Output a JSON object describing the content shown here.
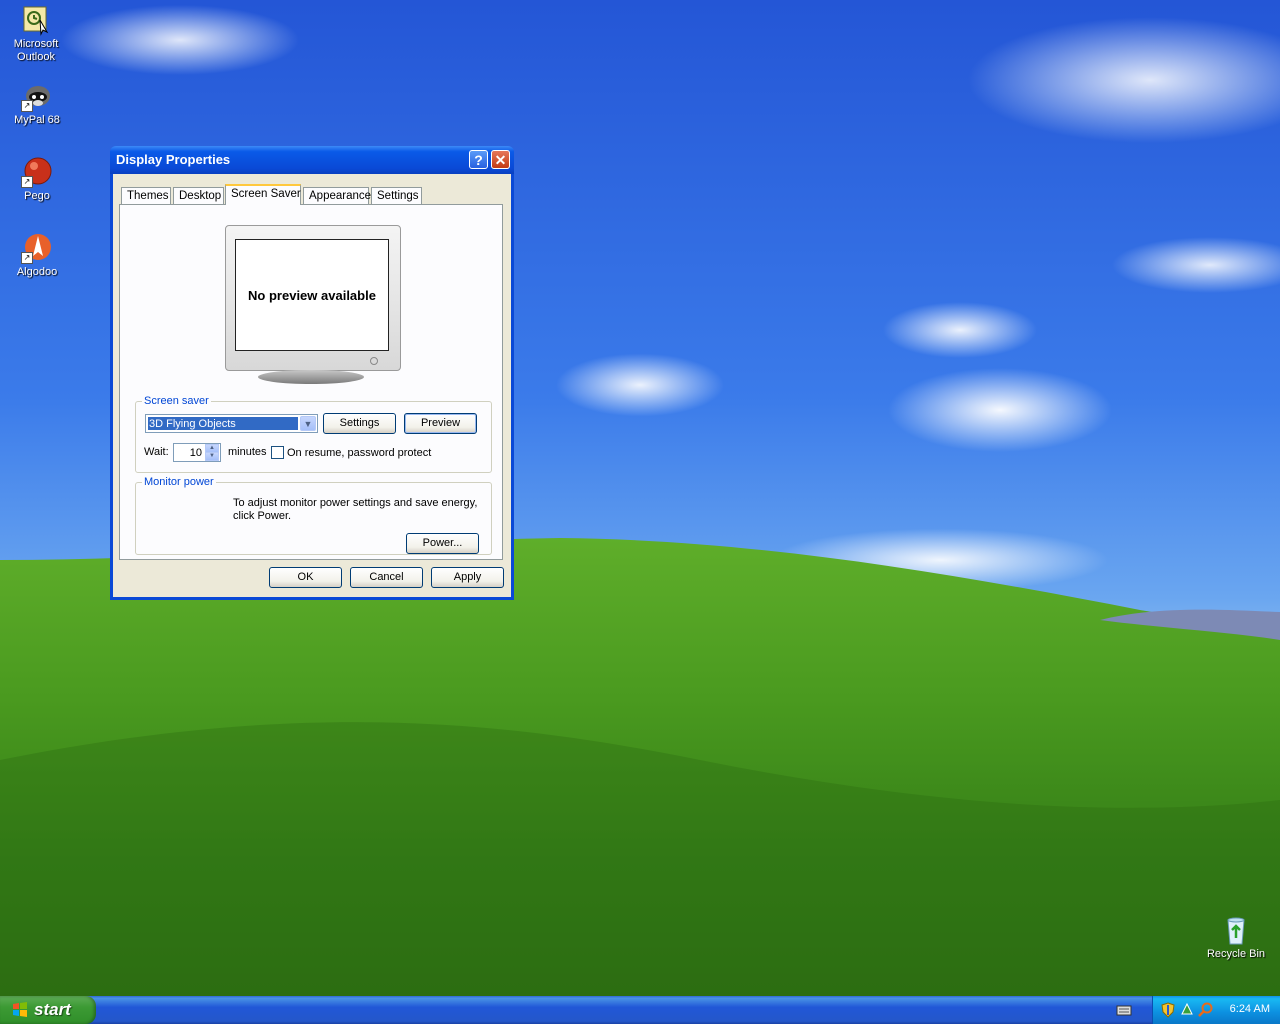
{
  "desktop": {
    "icons": [
      {
        "label_line1": "Microsoft",
        "label_line2": "Outlook",
        "icon": "outlook-icon"
      },
      {
        "label_line1": "MyPal 68",
        "icon": "mypal-icon"
      },
      {
        "label_line1": "Pego",
        "icon": "pego-icon"
      },
      {
        "label_line1": "Algodoo",
        "icon": "algodoo-icon"
      },
      {
        "label_line1": "Recycle Bin",
        "icon": "recycle-bin-icon"
      }
    ]
  },
  "window": {
    "title": "Display Properties",
    "help_glyph": "?",
    "close_glyph": "✕",
    "tabs": [
      "Themes",
      "Desktop",
      "Screen Saver",
      "Appearance",
      "Settings"
    ],
    "active_tab": "Screen Saver",
    "preview_text": "No preview available",
    "screen_saver": {
      "group_label": "Screen saver",
      "selected": "3D Flying Objects",
      "settings_label": "Settings",
      "preview_label": "Preview",
      "wait_label": "Wait:",
      "wait_value": "10",
      "minutes_label": "minutes",
      "password_label": "On resume, password protect",
      "password_checked": false
    },
    "monitor_power": {
      "group_label": "Monitor power",
      "description_line1": "To adjust monitor power settings and save energy,",
      "description_line2": "click Power.",
      "power_label": "Power..."
    },
    "buttons": {
      "ok": "OK",
      "cancel": "Cancel",
      "apply": "Apply"
    }
  },
  "taskbar": {
    "start_label": "start",
    "clock": "6:24 AM"
  }
}
